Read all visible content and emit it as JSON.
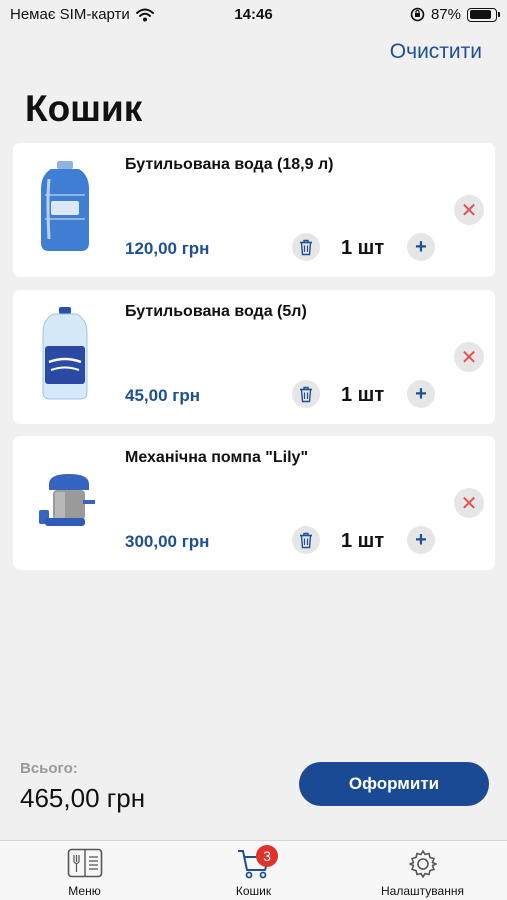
{
  "status_bar": {
    "carrier": "Немає SIM-карти",
    "time": "14:46",
    "battery": "87%",
    "battery_level": 0.87
  },
  "header": {
    "clear_label": "Очистити",
    "title": "Кошик"
  },
  "cart": {
    "items": [
      {
        "name": "Бутильована вода (18,9 л)",
        "price": "120,00 грн",
        "quantity": "1 шт"
      },
      {
        "name": "Бутильована вода (5л)",
        "price": "45,00 грн",
        "quantity": "1 шт"
      },
      {
        "name": "Механічна помпа \"Lily\"",
        "price": "300,00 грн",
        "quantity": "1 шт"
      }
    ]
  },
  "footer": {
    "total_label": "Всього:",
    "total_value": "465,00 грн",
    "checkout_label": "Оформити"
  },
  "tab_bar": {
    "tabs": [
      {
        "label": "Меню",
        "icon": "menu-book-icon"
      },
      {
        "label": "Кошик",
        "icon": "cart-icon",
        "badge": "3"
      },
      {
        "label": "Налаштування",
        "icon": "gear-icon"
      }
    ]
  },
  "colors": {
    "accent": "#1f4f94",
    "button": "#1a4a93",
    "remove": "#e2504f",
    "badge": "#e2302a"
  }
}
